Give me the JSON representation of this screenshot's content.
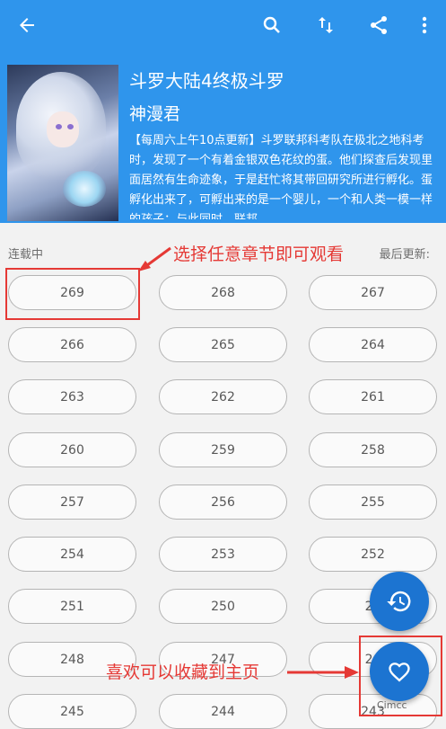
{
  "topbar": {
    "icons": [
      "back-arrow-icon",
      "search-icon",
      "sort-icon",
      "share-icon",
      "more-vert-icon"
    ]
  },
  "book": {
    "title": "斗罗大陆4终极斗罗",
    "author": "神漫君",
    "description": "【每周六上午10点更新】斗罗联邦科考队在极北之地科考时，发现了一个有着金银双色花纹的蛋。他们探查后发现里面居然有生命迹象，于是赶忙将其带回研究所进行孵化。蛋孵化出来了，可孵出来的是一个婴儿，一个和人类一模一样的孩子；与此同时，联邦…"
  },
  "status": {
    "serial": "连载中",
    "updated_label": "最后更新:"
  },
  "annotations": {
    "choose_chapter": "选择任意章节即可观看",
    "favorite": "喜欢可以收藏到主页"
  },
  "chapters": [
    "269",
    "268",
    "267",
    "266",
    "265",
    "264",
    "263",
    "262",
    "261",
    "260",
    "259",
    "258",
    "257",
    "256",
    "255",
    "254",
    "253",
    "252",
    "251",
    "250",
    "25",
    "248",
    "247",
    "24",
    "245",
    "244",
    "243"
  ],
  "fab": {
    "history_icon": "history-icon",
    "favorite_icon": "heart-icon"
  },
  "watermark": "Cimcc",
  "colors": {
    "primary": "#2f95ec",
    "fab": "#1c74d1",
    "annotation": "#e53935"
  }
}
